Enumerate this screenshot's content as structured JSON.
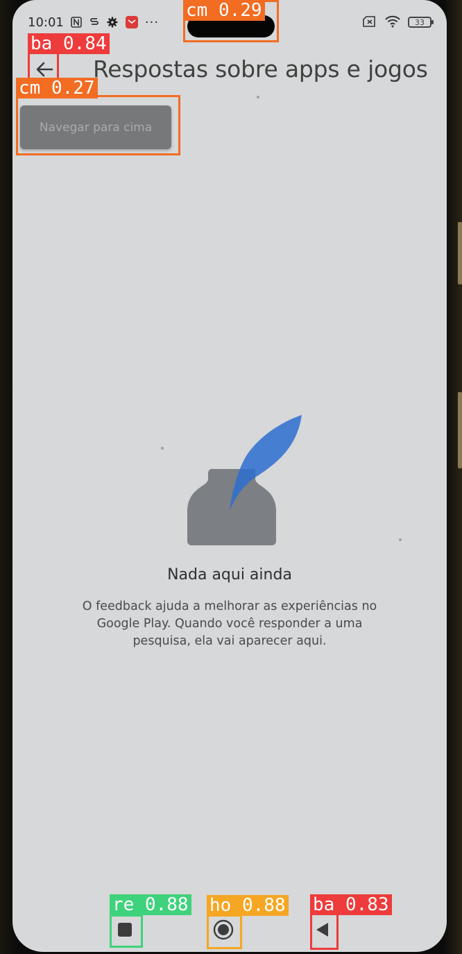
{
  "status_bar": {
    "time": "10:01",
    "battery": "33"
  },
  "toolbar": {
    "title": "Respostas sobre apps e jogos",
    "back_icon": "arrow-left-icon",
    "tooltip": "Navegar para cima"
  },
  "empty_state": {
    "illustration": "inkwell-feather-illustration",
    "title": "Nada aqui ainda",
    "body": "O feedback ajuda a melhorar as experiências no Google Play. Quando você responder a uma pesquisa, ela vai aparecer aqui."
  },
  "nav_bar": {
    "recents_icon": "square-recents-icon",
    "home_icon": "circle-home-icon",
    "back_icon": "triangle-back-icon"
  },
  "detections": [
    {
      "label": "cm 0.29",
      "color": "#f26c22"
    },
    {
      "label": "ba 0.84",
      "color": "#ee3b3b"
    },
    {
      "label": "cm 0.27",
      "color": "#f26c22"
    },
    {
      "label": "re 0.88",
      "color": "#3fd27c"
    },
    {
      "label": "ho 0.88",
      "color": "#f5a623"
    },
    {
      "label": "ba 0.83",
      "color": "#ee3b3b"
    }
  ],
  "colors": {
    "screen_bg": "#d6d8d9",
    "feather_blue": "#2d6fd0",
    "inkwell_gray": "#7c7f83"
  }
}
